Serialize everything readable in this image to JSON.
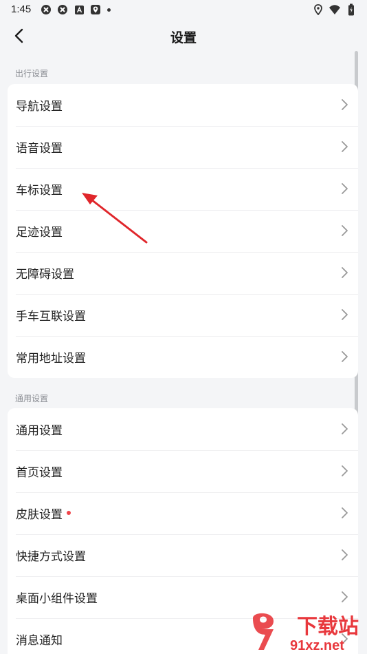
{
  "status_bar": {
    "time": "1:45",
    "left_icons": [
      "vpn-icon",
      "vpn-icon",
      "a-badge-icon",
      "map-pin-app-icon",
      "dot-icon"
    ],
    "right_icons": [
      "location-icon",
      "wifi-icon",
      "battery-icon"
    ]
  },
  "header": {
    "title": "设置",
    "back_icon": "chevron-left-icon"
  },
  "sections": [
    {
      "label": "出行设置",
      "items": [
        {
          "label": "导航设置"
        },
        {
          "label": "语音设置"
        },
        {
          "label": "车标设置"
        },
        {
          "label": "足迹设置"
        },
        {
          "label": "无障碍设置"
        },
        {
          "label": "手车互联设置"
        },
        {
          "label": "常用地址设置"
        }
      ]
    },
    {
      "label": "通用设置",
      "items": [
        {
          "label": "通用设置"
        },
        {
          "label": "首页设置"
        },
        {
          "label": "皮肤设置",
          "badge": "red-dot"
        },
        {
          "label": "快捷方式设置"
        },
        {
          "label": "桌面小组件设置"
        },
        {
          "label": "消息通知"
        }
      ]
    }
  ],
  "watermark": {
    "text_top": "下载站",
    "text_bottom": "91xz.net"
  },
  "colors": {
    "background": "#f4f5f7",
    "card": "#ffffff",
    "annotation_arrow": "#e0262b",
    "badge_dot": "#f0454a"
  }
}
